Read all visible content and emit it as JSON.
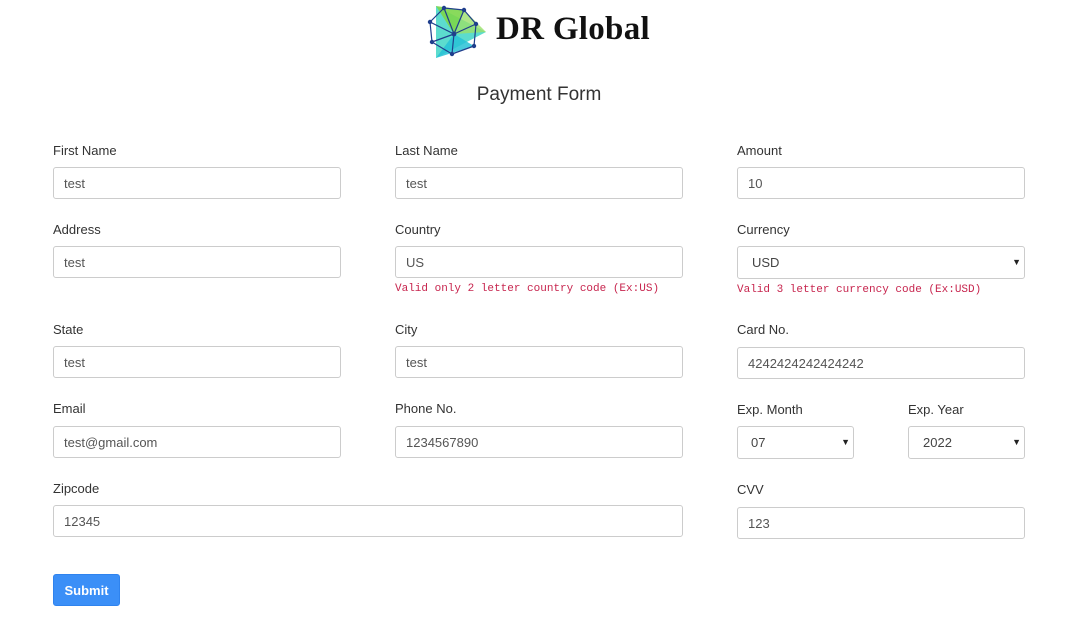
{
  "brand": {
    "name": "DR Global"
  },
  "form": {
    "title": "Payment Form",
    "fields": {
      "first_name": {
        "label": "First Name",
        "value": "test"
      },
      "last_name": {
        "label": "Last Name",
        "value": "test"
      },
      "amount": {
        "label": "Amount",
        "value": "10"
      },
      "address": {
        "label": "Address",
        "value": "test"
      },
      "country": {
        "label": "Country",
        "value": "US",
        "help": "Valid only 2 letter country code (Ex:US)"
      },
      "currency": {
        "label": "Currency",
        "value": "USD",
        "help": "Valid 3 letter currency code (Ex:USD)"
      },
      "state": {
        "label": "State",
        "value": "test"
      },
      "city": {
        "label": "City",
        "value": "test"
      },
      "card_no": {
        "label": "Card No.",
        "value": "4242424242424242"
      },
      "email": {
        "label": "Email",
        "value": "test@gmail.com"
      },
      "phone": {
        "label": "Phone No.",
        "value": "1234567890"
      },
      "exp_month": {
        "label": "Exp. Month",
        "value": "07"
      },
      "exp_year": {
        "label": "Exp. Year",
        "value": "2022"
      },
      "zipcode": {
        "label": "Zipcode",
        "value": "12345"
      },
      "cvv": {
        "label": "CVV",
        "value": "123"
      }
    },
    "submit_label": "Submit"
  },
  "colors": {
    "accent": "#3b8ff7",
    "help_text": "#c7254e"
  },
  "icons": {
    "logo": "polyhedron-triangle-logo",
    "select_arrow": "caret-down-icon"
  }
}
